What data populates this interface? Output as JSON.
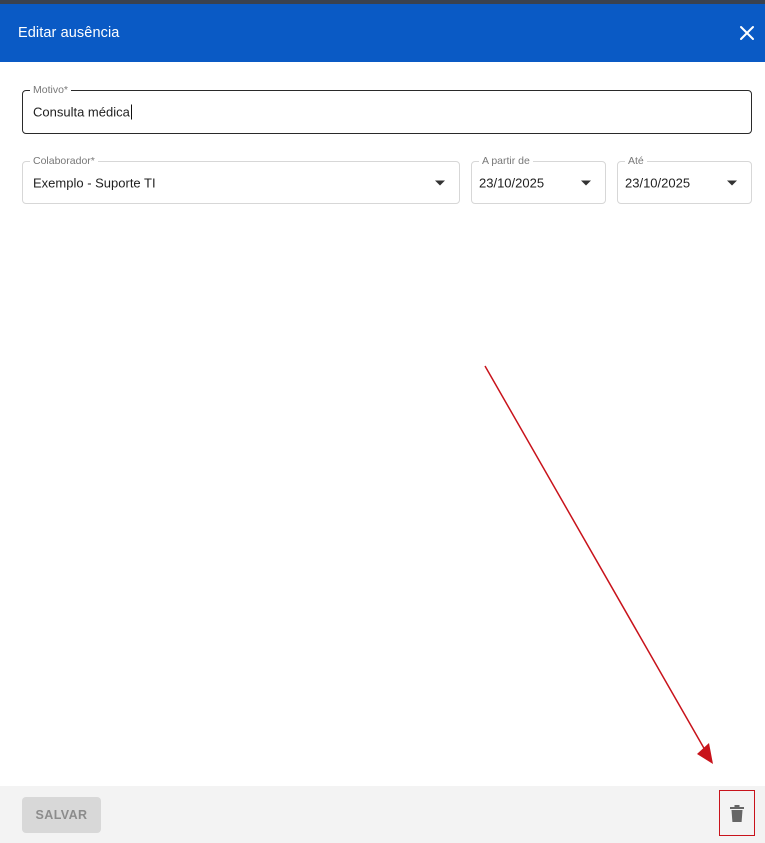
{
  "dialog": {
    "title": "Editar ausência",
    "close_icon": "close-icon"
  },
  "form": {
    "motivo": {
      "label": "Motivo*",
      "value": "Consulta médica"
    },
    "colaborador": {
      "label": "Colaborador*",
      "value": "Exemplo - Suporte TI"
    },
    "from_date": {
      "label": "A partir de",
      "value": "23/10/2025"
    },
    "to_date": {
      "label": "Até",
      "value": "23/10/2025"
    }
  },
  "footer": {
    "save_label": "SALVAR",
    "delete_icon": "trash-icon"
  },
  "colors": {
    "header_bg": "#0a5ac5",
    "annotation": "#c8131b"
  }
}
